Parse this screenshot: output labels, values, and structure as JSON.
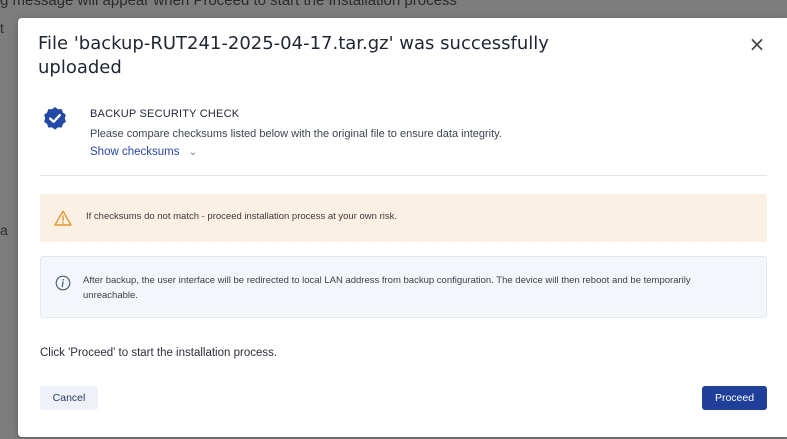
{
  "background": {
    "top_text": "g message will appear when Proceed to start the Installation process",
    "side_text_1": "t",
    "side_text_2": "a"
  },
  "dialog": {
    "title": "File 'backup-RUT241-2025-04-17.tar.gz' was successfully uploaded",
    "close_icon": "×",
    "security_check": {
      "icon": "verified-shield-icon",
      "title": "BACKUP SECURITY CHECK",
      "description": "Please compare checksums listed below with the original file to ensure data integrity.",
      "toggle_label": "Show checksums",
      "toggle_icon": "chevron-down-icon"
    },
    "warning": {
      "icon": "warning-triangle-icon",
      "text": "If checksums do not match - proceed installation process at your own risk."
    },
    "info": {
      "icon": "info-circle-icon",
      "text": "After backup, the user interface will be redirected to local LAN address from backup configuration. The device will then reboot and be temporarily unreachable."
    },
    "hint": "Click 'Proceed' to start the installation process.",
    "buttons": {
      "cancel": "Cancel",
      "proceed": "Proceed"
    }
  },
  "colors": {
    "primary": "#1f3f9a",
    "warning_bg": "#fbf0e4",
    "warning_icon": "#e0982f",
    "info_bg": "#f3f6fb",
    "backdrop": "#7d7d7d"
  }
}
